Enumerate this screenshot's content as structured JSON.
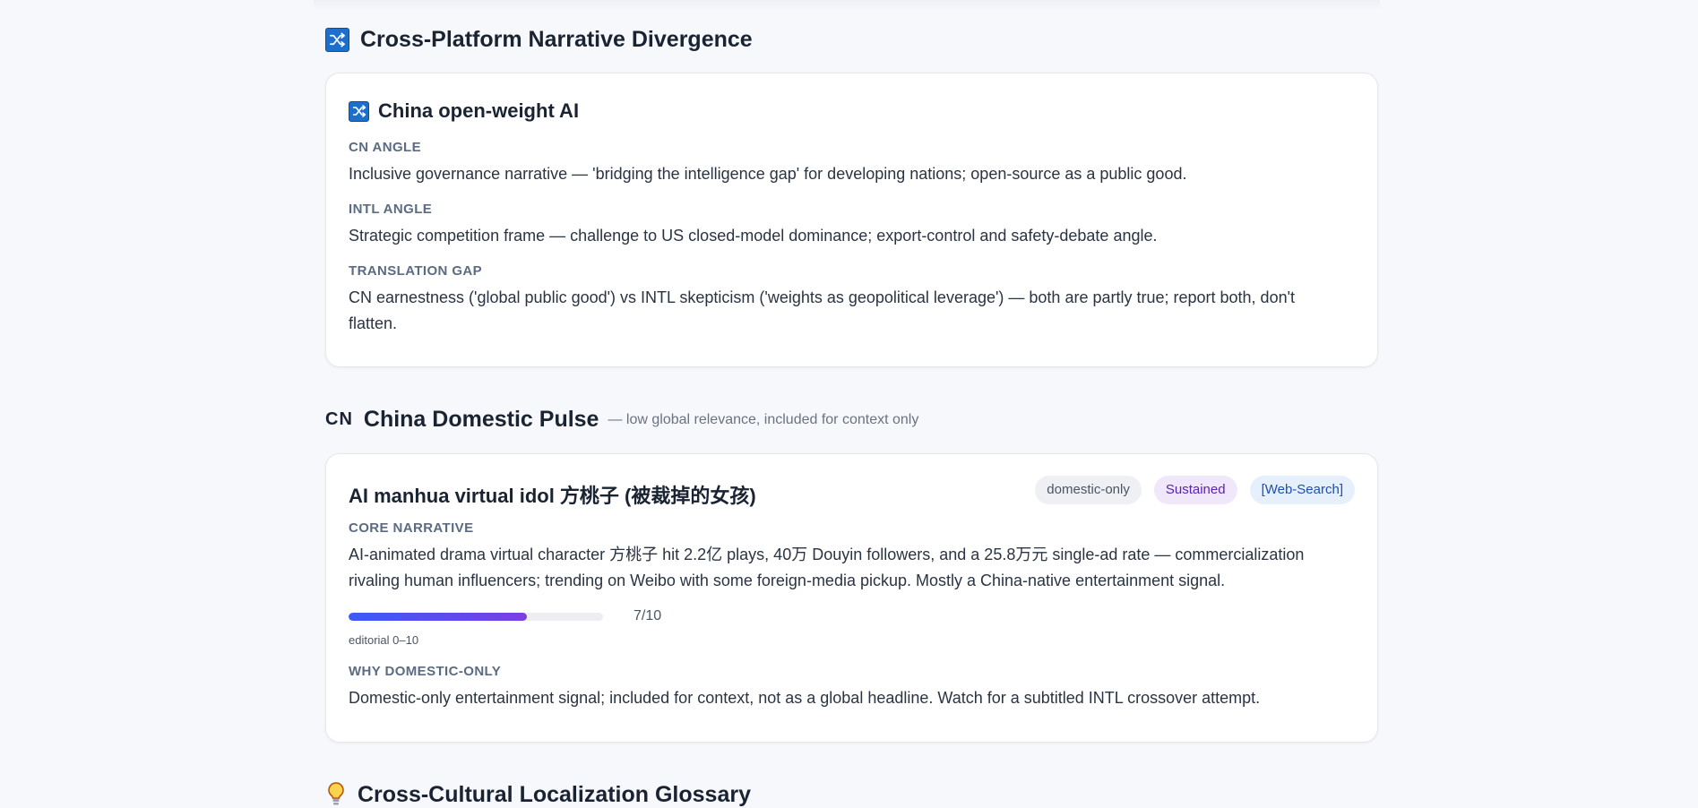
{
  "divergence": {
    "icon": "shuffle-icon",
    "title": "Cross-Platform Narrative Divergence",
    "card": {
      "icon": "shuffle-icon",
      "title": "China open-weight AI",
      "cn_label": "CN ANGLE",
      "cn_text": "Inclusive governance narrative — 'bridging the intelligence gap' for developing nations; open-source as a public good.",
      "intl_label": "INTL ANGLE",
      "intl_text": "Strategic competition frame — challenge to US closed-model dominance; export-control and safety-debate angle.",
      "gap_label": "TRANSLATION GAP",
      "gap_text": "CN earnestness ('global public good') vs INTL skepticism ('weights as geopolitical leverage') — both are partly true; report both, don't flatten."
    }
  },
  "domestic": {
    "tag": "CN",
    "title": "China Domestic Pulse",
    "note": "— low global relevance, included for context only",
    "card": {
      "title": "AI manhua virtual idol 方桃子 (被裁掉的女孩)",
      "tags": [
        "domestic-only",
        "Sustained",
        "[Web-Search]"
      ],
      "core_label": "CORE NARRATIVE",
      "core_text": "AI-animated drama virtual character 方桃子 hit 2.2亿 plays, 40万 Douyin followers, and a 25.8万元 single-ad rate — commercialization rivaling human influencers; trending on Weibo with some foreign-media pickup. Mostly a China-native entertainment signal.",
      "score_value": 7,
      "score_max": 10,
      "score_text": "7/10",
      "score_note": "editorial 0–10",
      "why_label": "WHY DOMESTIC-ONLY",
      "why_text": "Domestic-only entertainment signal; included for context, not as a global headline. Watch for a subtitled INTL crossover attempt."
    }
  },
  "glossary": {
    "icon": "lightbulb-icon",
    "title": "Cross-Cultural Localization Glossary"
  },
  "colors": {
    "accent_blue": "#1d70c9",
    "bar_start": "#3b5bf6",
    "bar_end": "#7b3fe4"
  }
}
